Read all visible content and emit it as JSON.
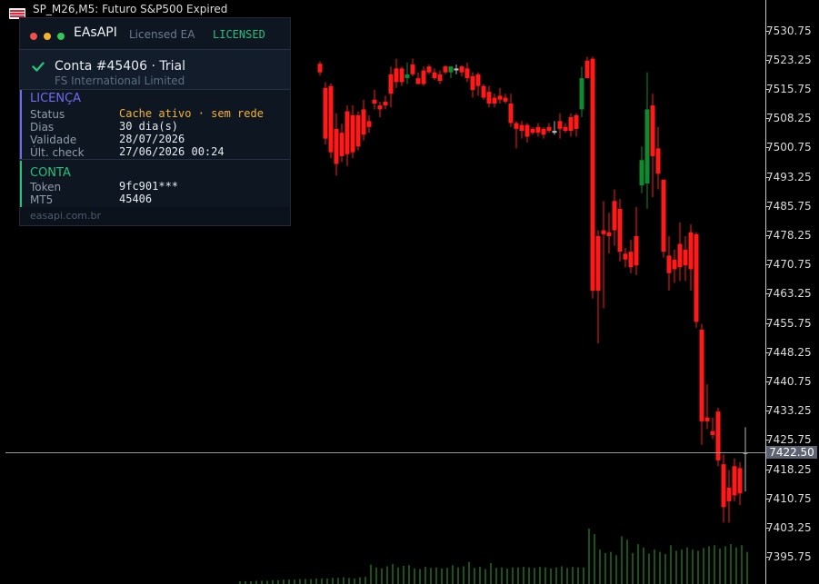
{
  "window": {
    "title": "SP_M26,M5: Futuro S&P500 Expired"
  },
  "price_axis": {
    "ticks": [
      "7530.75",
      "7523.25",
      "7515.75",
      "7508.25",
      "7500.75",
      "7493.25",
      "7485.75",
      "7478.25",
      "7470.75",
      "7463.25",
      "7455.75",
      "7448.25",
      "7440.75",
      "7433.25",
      "7425.75",
      "7418.25",
      "7410.75",
      "7403.25",
      "7395.75"
    ],
    "current_price": "7422.50"
  },
  "panel": {
    "brand": "EAsAPI",
    "subtitle": "Licensed EA",
    "status": "LICENSED",
    "account_title": "Conta #45406 · Trial",
    "account_company": "FS International Limited",
    "license_section": {
      "title": "LICENÇA",
      "rows": [
        {
          "label": "Status",
          "value": "Cache ativo · sem rede"
        },
        {
          "label": "Dias",
          "value": "30 dia(s)"
        },
        {
          "label": "Validade",
          "value": "28/07/2026"
        },
        {
          "label": "Últ. check",
          "value": "27/06/2026 00:24"
        }
      ]
    },
    "account_section": {
      "title": "CONTA",
      "rows": [
        {
          "label": "Token",
          "value": "9fc901***"
        },
        {
          "label": "MT5",
          "value": "45406"
        }
      ]
    },
    "footer": "easapi.com.br",
    "colors": {
      "dot_red": "#f0504a",
      "dot_yellow": "#f5b22f",
      "dot_green": "#35c759",
      "status_green": "#2bbf7a",
      "license_accent": "#6f6cf2",
      "account_accent": "#2bbf7a",
      "warning_value": "#f4b23a"
    }
  },
  "chart_data": {
    "type": "candlestick",
    "symbol": "SP_M26",
    "timeframe": "M5",
    "ylim": [
      7392,
      7535
    ],
    "current_price": 7422.5,
    "colors": {
      "bull": "#0f8a2e",
      "bear": "#ff1a1a",
      "doji": "#b8b8b8",
      "volume": "#2fa82f"
    },
    "candles": [
      [
        7522.2,
        7522.8,
        7519.2,
        7520.0
      ],
      [
        7516.0,
        7517.5,
        7501.5,
        7503.0
      ],
      [
        7516.5,
        7517.2,
        7498.0,
        7499.5
      ],
      [
        7505.5,
        7509.5,
        7493.5,
        7496.5
      ],
      [
        7504.5,
        7506.8,
        7497.0,
        7498.5
      ],
      [
        7510.0,
        7511.5,
        7496.0,
        7499.0
      ],
      [
        7509.0,
        7511.5,
        7498.0,
        7499.5
      ],
      [
        7509.0,
        7510.0,
        7500.0,
        7501.0
      ],
      [
        7510.5,
        7513.0,
        7502.5,
        7504.0
      ],
      [
        7507.5,
        7509.0,
        7504.5,
        7506.0
      ],
      [
        7513.0,
        7515.5,
        7510.5,
        7512.0
      ],
      [
        7511.5,
        7512.5,
        7508.5,
        7510.5
      ],
      [
        7512.5,
        7514.0,
        7510.5,
        7511.5
      ],
      [
        7519.5,
        7521.5,
        7511.0,
        7514.5
      ],
      [
        7521.0,
        7523.5,
        7516.0,
        7517.5
      ],
      [
        7521.0,
        7521.5,
        7516.5,
        7517.5
      ],
      [
        7518.5,
        7522.5,
        7517.0,
        7519.5
      ],
      [
        7522.0,
        7523.5,
        7519.0,
        7519.5
      ],
      [
        7518.5,
        7520.0,
        7517.5,
        7517.0
      ],
      [
        7520.5,
        7521.5,
        7516.5,
        7517.0
      ],
      [
        7521.5,
        7522.0,
        7519.5,
        7520.0
      ],
      [
        7520.0,
        7521.0,
        7518.0,
        7518.5
      ],
      [
        7519.5,
        7520.5,
        7517.0,
        7517.8
      ],
      [
        7521.5,
        7521.8,
        7519.5,
        7520.0
      ],
      [
        7520.0,
        7521.5,
        7518.5,
        7521.5
      ],
      [
        7521.0,
        7522.0,
        7519.5,
        7520.5
      ],
      [
        7521.5,
        7521.8,
        7519.0,
        7520.0
      ],
      [
        7521.0,
        7522.5,
        7517.5,
        7518.5
      ],
      [
        7519.0,
        7520.0,
        7513.5,
        7515.5
      ],
      [
        7519.5,
        7520.0,
        7514.0,
        7516.5
      ],
      [
        7516.5,
        7517.0,
        7513.0,
        7513.5
      ],
      [
        7515.0,
        7516.5,
        7511.0,
        7512.0
      ],
      [
        7513.5,
        7514.5,
        7511.0,
        7512.0
      ],
      [
        7514.0,
        7516.0,
        7512.0,
        7513.0
      ],
      [
        7513.5,
        7514.5,
        7512.0,
        7512.5
      ],
      [
        7512.0,
        7514.5,
        7506.0,
        7507.0
      ],
      [
        7507.0,
        7507.5,
        7500.5,
        7505.5
      ],
      [
        7506.5,
        7507.5,
        7503.0,
        7505.0
      ],
      [
        7506.5,
        7507.0,
        7502.0,
        7503.5
      ],
      [
        7505.5,
        7506.0,
        7504.0,
        7504.5
      ],
      [
        7506.0,
        7507.0,
        7503.5,
        7504.5
      ],
      [
        7505.5,
        7506.0,
        7503.0,
        7504.0
      ],
      [
        7506.0,
        7507.0,
        7504.5,
        7505.0
      ],
      [
        7505.0,
        7507.5,
        7504.0,
        7504.5
      ],
      [
        7507.5,
        7509.5,
        7503.0,
        7505.5
      ],
      [
        7506.0,
        7507.0,
        7504.5,
        7505.0
      ],
      [
        7508.5,
        7509.5,
        7503.5,
        7505.0
      ],
      [
        7509.0,
        7509.5,
        7503.5,
        7505.5
      ],
      [
        7510.5,
        7521.5,
        7508.5,
        7518.5
      ],
      [
        7523.0,
        7524.0,
        7519.0,
        7518.5
      ],
      [
        7523.5,
        7524.0,
        7462.0,
        7464.0
      ],
      [
        7478.0,
        7479.5,
        7450.5,
        7464.0
      ],
      [
        7479.5,
        7487.0,
        7459.5,
        7478.5
      ],
      [
        7479.0,
        7484.0,
        7473.5,
        7478.0
      ],
      [
        7487.0,
        7490.0,
        7475.5,
        7479.5
      ],
      [
        7485.0,
        7487.5,
        7471.5,
        7474.0
      ],
      [
        7473.5,
        7475.0,
        7470.0,
        7472.0
      ],
      [
        7474.0,
        7477.0,
        7468.5,
        7470.0
      ],
      [
        7478.0,
        7485.5,
        7468.0,
        7470.5
      ],
      [
        7491.0,
        7501.0,
        7489.0,
        7497.5
      ],
      [
        7491.5,
        7520.0,
        7485.0,
        7510.5
      ],
      [
        7511.5,
        7514.5,
        7488.0,
        7498.5
      ],
      [
        7500.5,
        7506.0,
        7490.0,
        7494.0
      ],
      [
        7492.5,
        7491.5,
        7472.5,
        7474.0
      ],
      [
        7473.0,
        7478.0,
        7464.0,
        7468.5
      ],
      [
        7472.0,
        7474.5,
        7466.0,
        7469.5
      ],
      [
        7476.0,
        7481.5,
        7466.5,
        7470.0
      ],
      [
        7474.5,
        7478.0,
        7466.5,
        7470.5
      ],
      [
        7479.0,
        7481.0,
        7464.0,
        7469.5
      ],
      [
        7478.5,
        7479.0,
        7454.5,
        7456.0
      ],
      [
        7454.0,
        7455.5,
        7424.5,
        7430.5
      ],
      [
        7431.5,
        7440.0,
        7428.5,
        7430.5
      ],
      [
        7428.0,
        7431.5,
        7426.0,
        7427.0
      ],
      [
        7433.0,
        7434.0,
        7419.0,
        7420.5
      ],
      [
        7419.5,
        7422.0,
        7404.5,
        7408.5
      ],
      [
        7413.5,
        7418.0,
        7404.5,
        7410.0
      ],
      [
        7419.0,
        7421.0,
        7410.0,
        7411.5
      ],
      [
        7418.5,
        7420.0,
        7409.0,
        7412.0
      ],
      [
        7422.5,
        7429.0,
        7412.5,
        7422.5
      ]
    ],
    "volumes": [
      0.05,
      0.05,
      0.05,
      0.06,
      0.06,
      0.06,
      0.07,
      0.07,
      0.08,
      0.08,
      0.08,
      0.09,
      0.09,
      0.09,
      0.1,
      0.1,
      0.1,
      0.11,
      0.11,
      0.12,
      0.11,
      0.1,
      0.12,
      0.13,
      0.35,
      0.3,
      0.28,
      0.32,
      0.36,
      0.3,
      0.33,
      0.34,
      0.28,
      0.27,
      0.31,
      0.29,
      0.3,
      0.28,
      0.29,
      0.34,
      0.3,
      0.32,
      0.4,
      0.29,
      0.31,
      0.27,
      0.38,
      0.29,
      0.3,
      0.28,
      0.3,
      0.3,
      0.31,
      0.3,
      0.29,
      0.31,
      0.3,
      0.28,
      0.3,
      0.32,
      0.29,
      0.31,
      0.3,
      0.3,
      1.0,
      0.9,
      0.62,
      0.56,
      0.58,
      0.52,
      0.86,
      0.8,
      0.56,
      0.72,
      0.66,
      0.55,
      0.62,
      0.58,
      0.54,
      0.7,
      0.6,
      0.62,
      0.66,
      0.62,
      0.6,
      0.65,
      0.68,
      0.7,
      0.64,
      0.68,
      0.72,
      0.66,
      0.7,
      0.58
    ]
  }
}
